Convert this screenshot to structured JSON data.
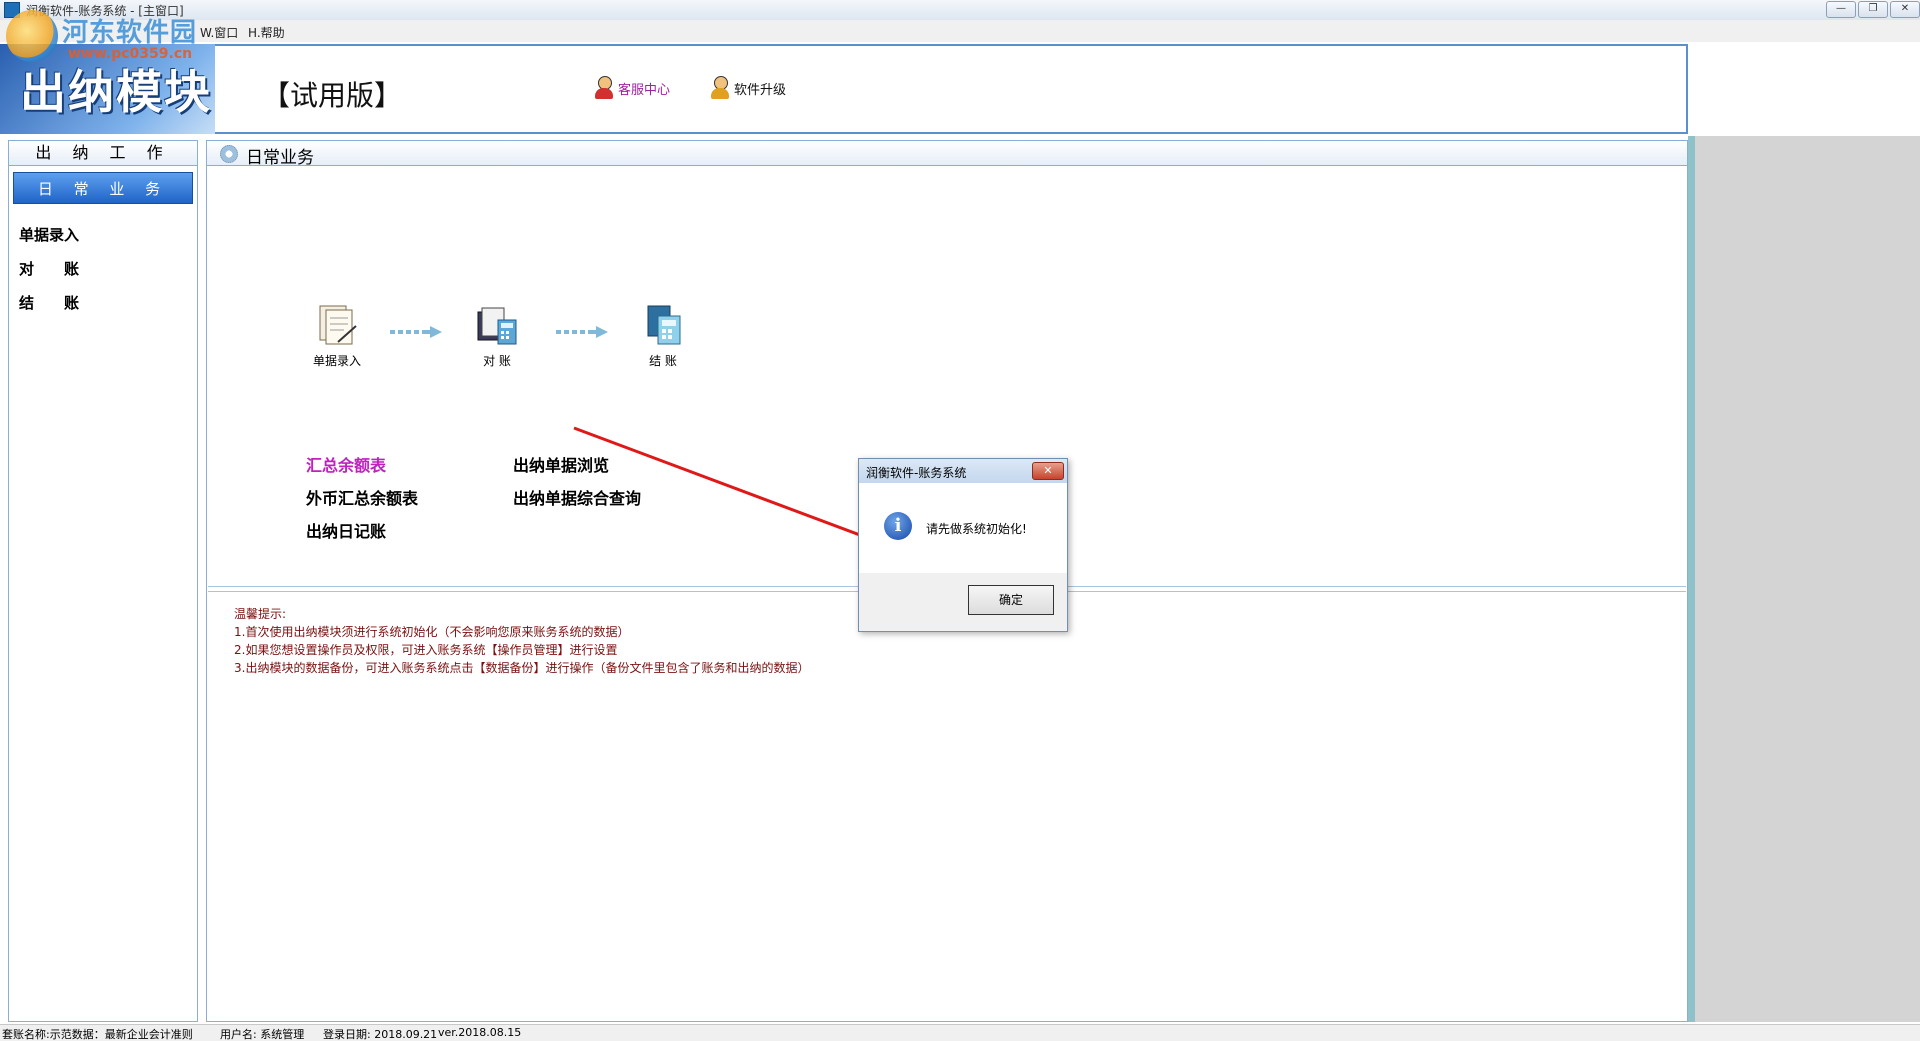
{
  "window": {
    "title": "润衡软件-账务系统 - [主窗口]",
    "controls": [
      "—",
      "❐",
      "✕"
    ]
  },
  "menubar": {
    "items": [
      "W.窗口",
      "H.帮助"
    ]
  },
  "watermark": {
    "site": "河东软件园",
    "url": "www.pc0359.cn"
  },
  "header": {
    "module_title": "出纳模块",
    "edition": "【试用版】",
    "customer_service": "客服中心",
    "upgrade": "软件升级",
    "accent_color": "#a020a0"
  },
  "sidebar": {
    "section_title": "出 纳 工 作",
    "active_item": "日 常 业 务",
    "items": [
      "单据录入",
      "对　　账",
      "结　　账"
    ]
  },
  "main": {
    "title": "日常业务",
    "workflow": [
      "单据录入",
      "对 账",
      "结 账"
    ],
    "links_left": [
      "汇总余额表",
      "外币汇总余额表",
      "出纳日记账"
    ],
    "links_right": [
      "出纳单据浏览",
      "出纳单据综合查询"
    ],
    "tips": [
      "温馨提示:",
      "1.首次使用出纳模块须进行系统初始化（不会影响您原来账务系统的数据）",
      "2.如果您想设置操作员及权限，可进入账务系统【操作员管理】进行设置",
      "3.出纳模块的数据备份，可进入账务系统点击【数据备份】进行操作（备份文件里包含了账务和出纳的数据）"
    ]
  },
  "dialog": {
    "title": "润衡软件-账务系统",
    "message": "请先做系统初始化!",
    "ok_button": "确定"
  },
  "statusbar": {
    "set_name": "套账名称:示范数据：最新企业会计准则",
    "user": "用户名: 系统管理",
    "login_date": "登录日期: 2018.09.21",
    "version": "ver.2018.08.15"
  }
}
